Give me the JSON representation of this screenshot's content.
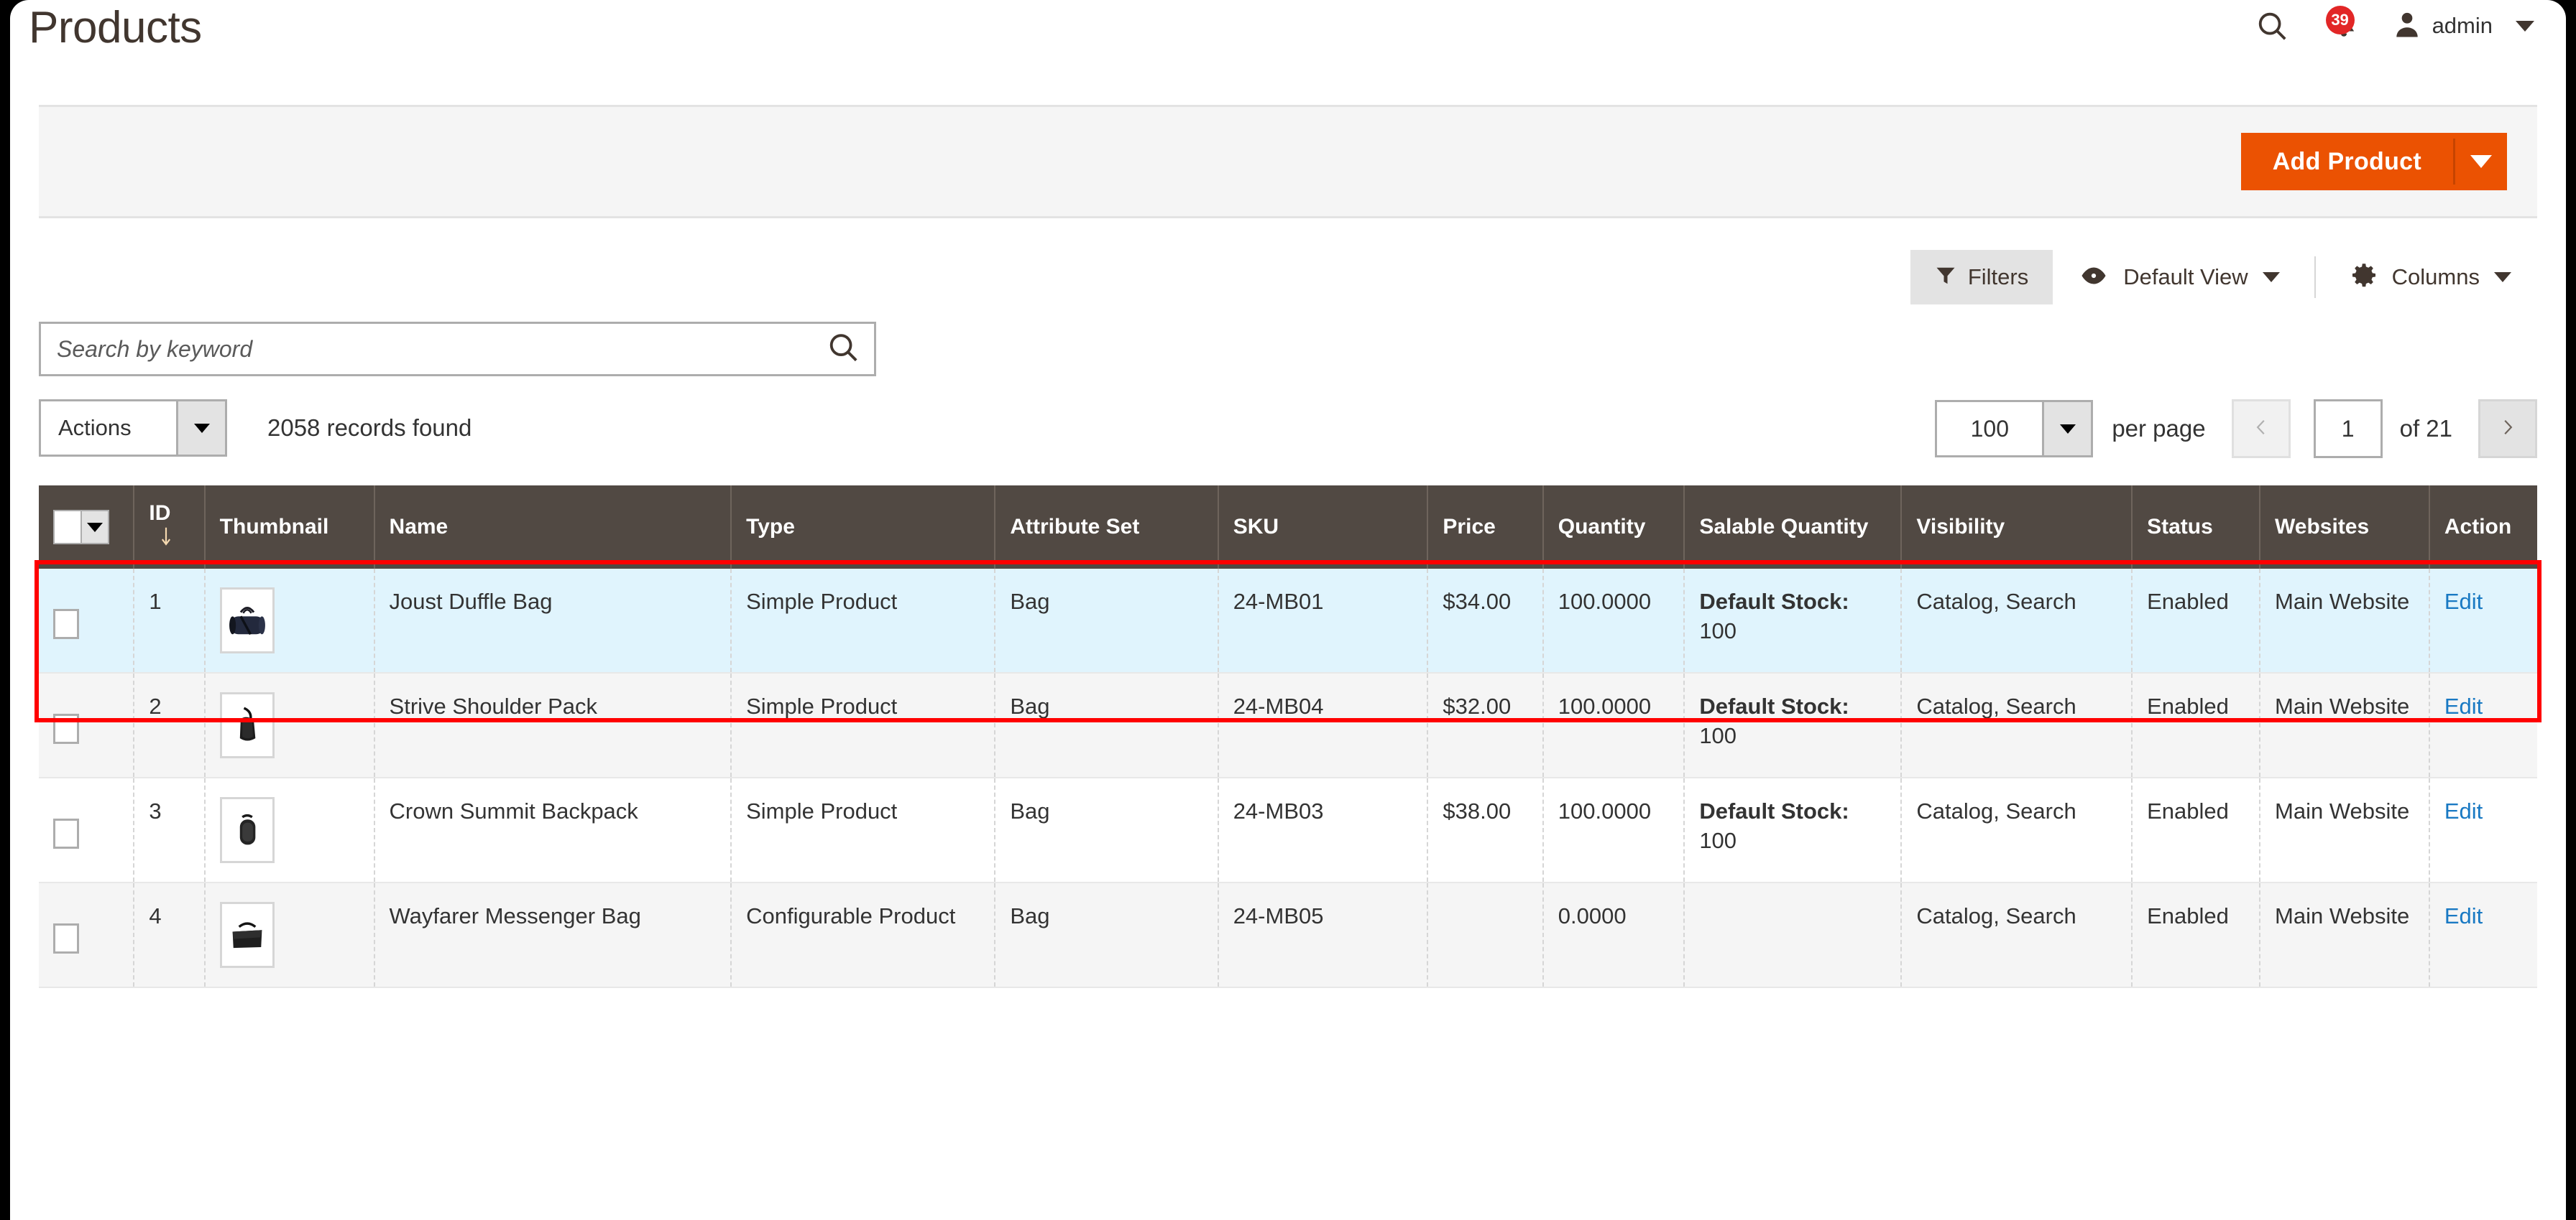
{
  "header": {
    "title": "Products",
    "search_icon": "search-icon",
    "notifications_icon": "bell-icon",
    "notifications_count": "39",
    "user_icon": "user-avatar-icon",
    "user_name": "admin",
    "user_caret": "chevron-down-icon"
  },
  "page_actions": {
    "add_product_label": "Add Product",
    "add_product_caret": "chevron-down-icon",
    "accent_color": "#eb5202"
  },
  "grid_controls": {
    "filters_label": "Filters",
    "filters_icon": "funnel-icon",
    "view_icon": "eye-icon",
    "view_label": "Default View",
    "columns_icon": "gear-icon",
    "columns_label": "Columns"
  },
  "search": {
    "placeholder": "Search by keyword",
    "value": "",
    "submit_icon": "search-icon"
  },
  "actions": {
    "label": "Actions",
    "records_found": "2058 records found"
  },
  "pager": {
    "per_page_value": "100",
    "per_page_label": "per page",
    "prev_icon": "chevron-left-icon",
    "next_icon": "chevron-right-icon",
    "current_page": "1",
    "of_label": "of 21"
  },
  "table": {
    "columns": [
      {
        "key": "select",
        "label": ""
      },
      {
        "key": "id",
        "label": "ID",
        "sort": "desc"
      },
      {
        "key": "thumbnail",
        "label": "Thumbnail"
      },
      {
        "key": "name",
        "label": "Name"
      },
      {
        "key": "type",
        "label": "Type"
      },
      {
        "key": "attribute_set",
        "label": "Attribute Set"
      },
      {
        "key": "sku",
        "label": "SKU"
      },
      {
        "key": "price",
        "label": "Price"
      },
      {
        "key": "quantity",
        "label": "Quantity"
      },
      {
        "key": "salable_quantity",
        "label": "Salable Quantity"
      },
      {
        "key": "visibility",
        "label": "Visibility"
      },
      {
        "key": "status",
        "label": "Status"
      },
      {
        "key": "websites",
        "label": "Websites"
      },
      {
        "key": "action",
        "label": "Action"
      }
    ],
    "rows": [
      {
        "id": "1",
        "thumbnail_alt": "joust-duffle-bag-thumbnail",
        "name": "Joust Duffle Bag",
        "type": "Simple Product",
        "attribute_set": "Bag",
        "sku": "24-MB01",
        "price": "$34.00",
        "quantity": "100.0000",
        "salable_label": "Default Stock:",
        "salable_value": "100",
        "visibility": "Catalog, Search",
        "status": "Enabled",
        "websites": "Main Website",
        "action": "Edit",
        "highlighted": true
      },
      {
        "id": "2",
        "thumbnail_alt": "strive-shoulder-pack-thumbnail",
        "name": "Strive Shoulder Pack",
        "type": "Simple Product",
        "attribute_set": "Bag",
        "sku": "24-MB04",
        "price": "$32.00",
        "quantity": "100.0000",
        "salable_label": "Default Stock:",
        "salable_value": "100",
        "visibility": "Catalog, Search",
        "status": "Enabled",
        "websites": "Main Website",
        "action": "Edit",
        "highlighted": false
      },
      {
        "id": "3",
        "thumbnail_alt": "crown-summit-backpack-thumbnail",
        "name": "Crown Summit Backpack",
        "type": "Simple Product",
        "attribute_set": "Bag",
        "sku": "24-MB03",
        "price": "$38.00",
        "quantity": "100.0000",
        "salable_label": "Default Stock:",
        "salable_value": "100",
        "visibility": "Catalog, Search",
        "status": "Enabled",
        "websites": "Main Website",
        "action": "Edit",
        "highlighted": false
      },
      {
        "id": "4",
        "thumbnail_alt": "wayfarer-messenger-bag-thumbnail",
        "name": "Wayfarer Messenger Bag",
        "type": "Configurable Product",
        "attribute_set": "Bag",
        "sku": "24-MB05",
        "price": "",
        "quantity": "0.0000",
        "salable_label": "",
        "salable_value": "",
        "visibility": "Catalog, Search",
        "status": "Enabled",
        "websites": "Main Website",
        "action": "Edit",
        "highlighted": false
      }
    ]
  },
  "colors": {
    "accent_orange": "#eb5202",
    "header_brown": "#514943",
    "selected_row_blue": "#e0f4fd",
    "highlight_red": "#ff0000",
    "link_blue": "#1979c3",
    "badge_red": "#e22626"
  }
}
